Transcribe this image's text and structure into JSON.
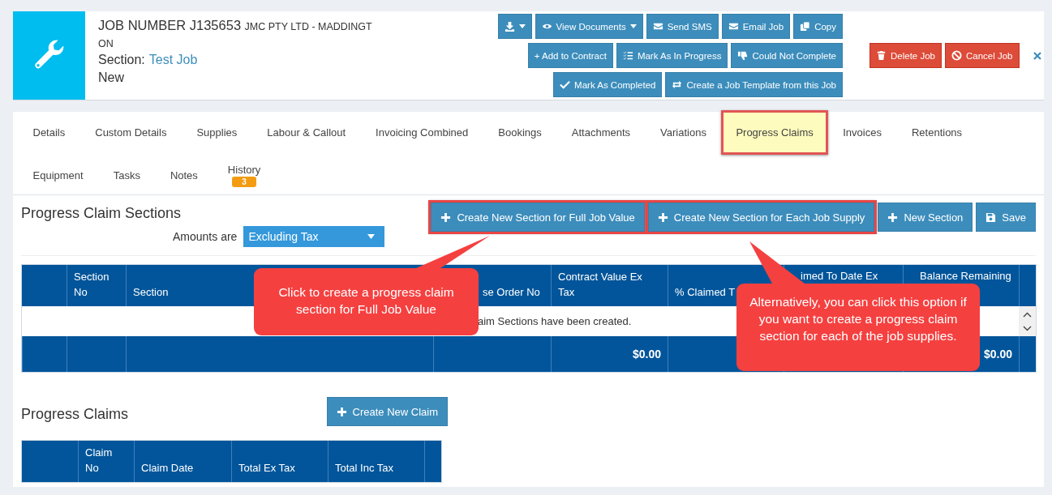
{
  "job": {
    "heading": "JOB NUMBER J135653",
    "customer": "JMC PTY LTD - MADDINGT",
    "customer_wrap": "ON",
    "section_label": "Section:",
    "section_value": "Test Job",
    "status": "New"
  },
  "toolbar_rows": [
    [
      {
        "kind": "icon-menu"
      },
      {
        "kind": "menu",
        "label": "View Documents"
      },
      {
        "kind": "plain",
        "label": "Send SMS"
      },
      {
        "kind": "plain",
        "label": "Email Job"
      },
      {
        "kind": "plain",
        "label": "Copy"
      }
    ],
    [
      {
        "kind": "text",
        "label": "+ Add to Contract"
      },
      {
        "kind": "plain",
        "label": "Mark As In Progress"
      },
      {
        "kind": "plain",
        "label": "Could Not Complete"
      }
    ],
    [
      {
        "kind": "plain",
        "label": "Mark As Completed"
      },
      {
        "kind": "plain",
        "label": "Create a Job Template from this Job"
      }
    ]
  ],
  "danger_buttons": [
    "Delete Job",
    "Cancel Job"
  ],
  "tabs": [
    {
      "label": "Details",
      "selected": false
    },
    {
      "label": "Custom Details",
      "selected": false
    },
    {
      "label": "Supplies",
      "selected": false
    },
    {
      "label": "Labour & Callout",
      "selected": false
    },
    {
      "label": "Invoicing Combined",
      "selected": false
    },
    {
      "label": "Bookings",
      "selected": false
    },
    {
      "label": "Attachments",
      "selected": false
    },
    {
      "label": "Variations",
      "selected": false
    },
    {
      "label": "Progress Claims",
      "selected": true
    },
    {
      "label": "Invoices",
      "selected": false
    },
    {
      "label": "Retentions",
      "selected": false
    },
    {
      "label": "Equipment",
      "selected": false
    },
    {
      "label": "Tasks",
      "selected": false
    },
    {
      "label": "Notes",
      "selected": false
    },
    {
      "label": "History",
      "selected": false,
      "badge": "3"
    }
  ],
  "sections": {
    "title": "Progress Claim Sections",
    "amounts_label": "Amounts are",
    "amounts_value": "Excluding Tax",
    "buttons": [
      {
        "label": "Create New Section for Full Job Value",
        "highlighted": true
      },
      {
        "label": "Create New Section for Each Job Supply",
        "highlighted": true
      },
      {
        "label": "New Section",
        "highlighted": false
      },
      {
        "label": "Save",
        "highlighted": false
      }
    ],
    "columns": [
      {
        "label": "Section No",
        "kind": "full"
      },
      {
        "label": "Section",
        "kind": "full"
      },
      {
        "label": "se Order No",
        "kind": "covered"
      },
      {
        "label": "Contract Value Ex Tax",
        "kind": "full"
      },
      {
        "label": "% Claimed T",
        "kind": "full"
      },
      {
        "label": "imed To Date Ex",
        "kind": "clipped"
      },
      {
        "label": "Balance Remaining",
        "kind": "clipped"
      }
    ],
    "empty_message": "aim Sections have been created.",
    "totals": [
      "$0.00",
      "$0.00"
    ]
  },
  "callouts": [
    "Click to create a progress claim section for Full Job Value",
    "Alternatively, you can click this option if you want to create a progress claim section for each of the job supplies."
  ],
  "claims": {
    "title": "Progress Claims",
    "button": "Create New Claim",
    "columns": [
      "Claim No",
      "Claim Date",
      "Total Ex Tax",
      "Total Inc Tax"
    ]
  }
}
